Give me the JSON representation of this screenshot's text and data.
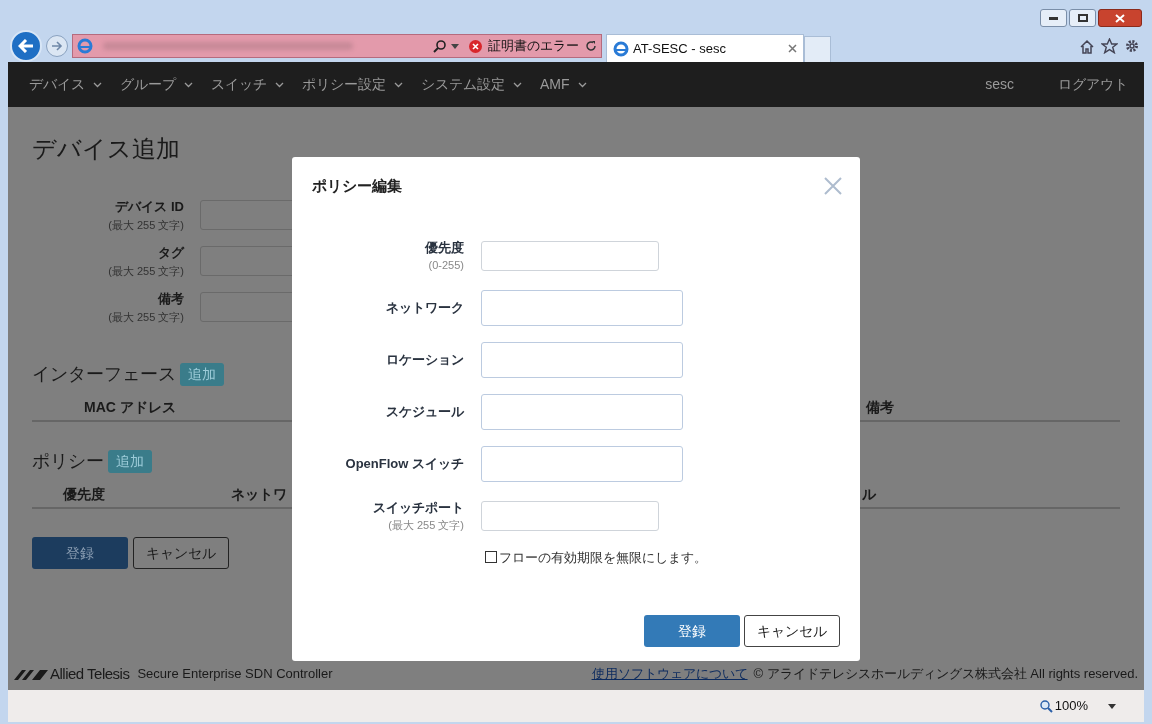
{
  "browser": {
    "address_status": "証明書のエラー",
    "tab_title": "AT-SESC - sesc",
    "zoom": "100%"
  },
  "nav": {
    "items": [
      "デバイス",
      "グループ",
      "スイッチ",
      "ポリシー設定",
      "システム設定",
      "AMF"
    ],
    "user": "sesc",
    "logout": "ログアウト"
  },
  "page": {
    "title": "デバイス追加",
    "fields": [
      {
        "label": "デバイス ID",
        "hint": "(最大 255 文字)"
      },
      {
        "label": "タグ",
        "hint": "(最大 255 文字)"
      },
      {
        "label": "備考",
        "hint": "(最大 255 文字)"
      }
    ],
    "interface_section": {
      "title": "インターフェース",
      "add_button": "追加",
      "columns": [
        "MAC アドレス",
        "備考"
      ]
    },
    "policy_section": {
      "title": "ポリシー",
      "add_button": "追加",
      "columns": [
        "優先度",
        "ネットワ",
        "ル"
      ]
    },
    "buttons": {
      "submit": "登録",
      "cancel": "キャンセル"
    }
  },
  "modal": {
    "title": "ポリシー編集",
    "fields": [
      {
        "label": "優先度",
        "hint": "(0-255)",
        "kind": "short"
      },
      {
        "label": "ネットワーク",
        "kind": "wide"
      },
      {
        "label": "ロケーション",
        "kind": "wide"
      },
      {
        "label": "スケジュール",
        "kind": "wide"
      },
      {
        "label": "OpenFlow スイッチ",
        "kind": "wide"
      },
      {
        "label": "スイッチポート",
        "hint": "(最大 255 文字)",
        "kind": "short"
      }
    ],
    "checkbox": {
      "label": "フローの有効期限を無限にします。",
      "checked": false
    },
    "buttons": {
      "submit": "登録",
      "cancel": "キャンセル"
    }
  },
  "footer": {
    "brand": "Allied Telesis",
    "product": "Secure Enterprise SDN Controller",
    "link": "使用ソフトウェアについて",
    "copyright": "© アライドテレシスホールディングス株式会社 All rights reserved."
  }
}
